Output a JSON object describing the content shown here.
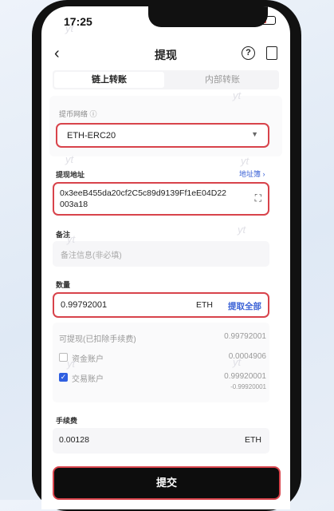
{
  "status_bar": {
    "time": "17:25"
  },
  "nav": {
    "title": "提现",
    "help_glyph": "?"
  },
  "tabs": [
    {
      "label": "链上转账",
      "active": true
    },
    {
      "label": "内部转账",
      "active": false
    }
  ],
  "network": {
    "label": "提币网络 ⓘ",
    "value": "ETH-ERC20"
  },
  "address": {
    "label": "提现地址",
    "book_link": "地址簿 ›",
    "line1": "0x3eeB455da20cf2C5c89d9139Ff1eE04D22",
    "line2": "003a18"
  },
  "memo": {
    "label": "备注",
    "placeholder": "备注信息(非必填)"
  },
  "amount": {
    "label": "数量",
    "value": "0.99792001",
    "unit": "ETH",
    "max_button": "提取全部"
  },
  "balances": {
    "available_label": "可提现(已扣除手续费)",
    "available_value": "0.99792001",
    "fund_account_label": "资金账户",
    "fund_account_value": "0.0004906",
    "fund_checked": false,
    "trade_account_label": "交易账户",
    "trade_account_value": "0.99920001",
    "trade_account_sub": "-0.99920001",
    "trade_checked": true
  },
  "fee": {
    "label": "手续费",
    "value": "0.00128",
    "unit": "ETH"
  },
  "submit_label": "提交",
  "watermark": "yt",
  "accent": "#2f5fe0",
  "highlight": "#d8434b"
}
